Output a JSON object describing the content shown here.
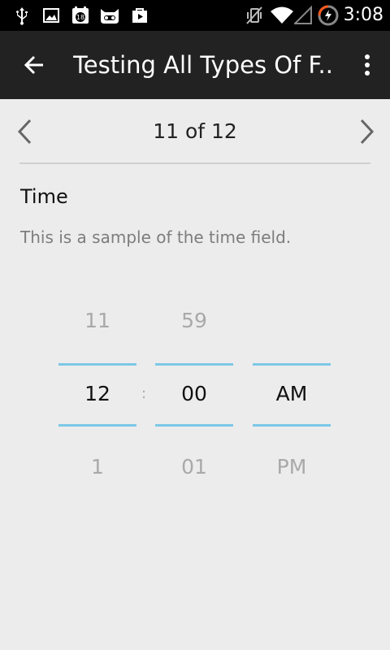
{
  "status_bar": {
    "time": "3:08",
    "left_icons": [
      "usb-icon",
      "image-icon",
      "calendar-icon",
      "cyanogen-icon",
      "play-store-icon"
    ],
    "right_icons": [
      "vibrate-icon",
      "wifi-icon",
      "signal-icon",
      "battery-charging-icon"
    ]
  },
  "action_bar": {
    "title": "Testing All Types Of F...",
    "back_icon": "arrow-back-icon",
    "overflow_icon": "overflow-menu-icon"
  },
  "pager": {
    "label": "11 of 12",
    "prev_icon": "chevron-left-icon",
    "next_icon": "chevron-right-icon"
  },
  "field": {
    "title": "Time",
    "description": "This is a sample of the time field."
  },
  "time_picker": {
    "separator": ":",
    "hour": {
      "prev": "11",
      "current": "12",
      "next": "1"
    },
    "minute": {
      "prev": "59",
      "current": "00",
      "next": "01"
    },
    "ampm": {
      "prev": "",
      "current": "AM",
      "next": "PM"
    },
    "accent_color": "#7cc8e6"
  }
}
